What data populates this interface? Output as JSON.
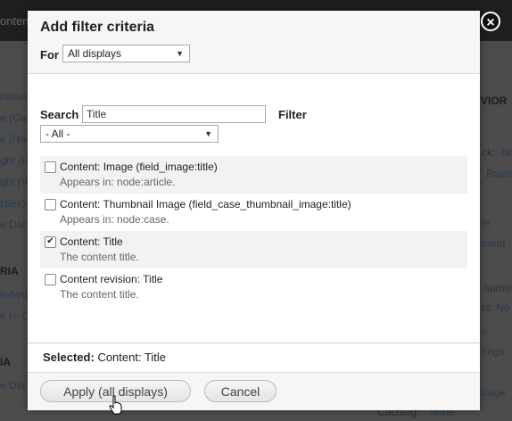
{
  "background": {
    "topbar_label": "onten",
    "side_links": [
      "mbna",
      "e (Cas",
      "e (Rac",
      "ght (H",
      "ght (W",
      "(Sex)",
      "e Dat",
      "RIA",
      "lished",
      "e (= C",
      "IA",
      "e Dat"
    ],
    "right_texts": [
      "VIOR",
      "ck:",
      "No",
      "Basic",
      "le",
      "ment",
      "summ",
      "ts:",
      "No",
      "o",
      "tings",
      "uage",
      "Caching:",
      "None"
    ]
  },
  "dialog": {
    "title": "Add filter criteria",
    "for_label": "For",
    "for_select_value": "All displays",
    "search_label": "Search",
    "search_value": "Title",
    "filter_label": "Filter",
    "filter_select_value": "- All -",
    "items": [
      {
        "title": "Content: Image (field_image:title)",
        "desc": "Appears in: node:article.",
        "checked": false
      },
      {
        "title": "Content: Thumbnail Image (field_case_thumbnail_image:title)",
        "desc": "Appears in: node:case.",
        "checked": false
      },
      {
        "title": "Content: Title",
        "desc": "The content title.",
        "checked": true
      },
      {
        "title": "Content revision: Title",
        "desc": "The content title.",
        "checked": false
      }
    ],
    "selected_label": "Selected:",
    "selected_value": "Content: Title",
    "apply_label": "Apply (all displays)",
    "cancel_label": "Cancel"
  }
}
